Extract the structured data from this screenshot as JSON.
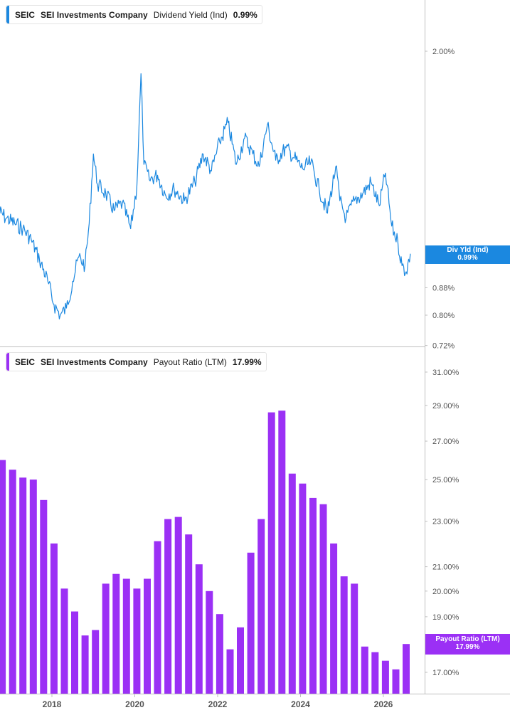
{
  "colors": {
    "dividend": "#1b88e0",
    "payout": "#9b30f5",
    "axis": "#bfbfbf",
    "tick_text": "#555555"
  },
  "top_legend": {
    "ticker": "SEIC",
    "company": "SEI Investments Company",
    "metric": "Dividend Yield (Ind)",
    "value": "0.99%"
  },
  "bottom_legend": {
    "ticker": "SEIC",
    "company": "SEI Investments Company",
    "metric": "Payout Ratio (LTM)",
    "value": "17.99%"
  },
  "top_tag": {
    "label": "Div Yld (Ind)",
    "value": "0.99%"
  },
  "bottom_tag": {
    "label": "Payout Ratio (LTM)",
    "value": "17.99%"
  },
  "chart_data": [
    {
      "type": "line",
      "series": [
        {
          "name": "Dividend Yield (Ind)",
          "unit": "%"
        }
      ],
      "y_scale": "log",
      "y_ticks": [
        "2.00%",
        "0.88%",
        "0.80%",
        "0.72%"
      ],
      "x": [
        2016.5,
        2016.7,
        2016.9,
        2017.1,
        2017.3,
        2017.5,
        2017.7,
        2017.9,
        2018.05,
        2018.2,
        2018.35,
        2018.5,
        2018.65,
        2018.8,
        2018.9,
        2019.0,
        2019.1,
        2019.3,
        2019.5,
        2019.7,
        2019.9,
        2020.05,
        2020.15,
        2020.22,
        2020.35,
        2020.55,
        2020.75,
        2020.95,
        2021.2,
        2021.45,
        2021.65,
        2021.85,
        2022.05,
        2022.25,
        2022.45,
        2022.65,
        2022.85,
        2023.0,
        2023.2,
        2023.4,
        2023.65,
        2023.85,
        2024.05,
        2024.25,
        2024.45,
        2024.65,
        2024.85,
        2024.95,
        2025.1,
        2025.3,
        2025.5,
        2025.7,
        2025.9,
        2026.05,
        2026.2,
        2026.35,
        2026.45,
        2026.55,
        2026.65
      ],
      "y": [
        1.16,
        1.15,
        1.12,
        1.1,
        1.08,
        1.04,
        0.97,
        0.9,
        0.83,
        0.8,
        0.82,
        0.9,
        0.98,
        0.95,
        1.1,
        1.4,
        1.26,
        1.22,
        1.15,
        1.18,
        1.08,
        1.25,
        1.85,
        1.35,
        1.28,
        1.3,
        1.21,
        1.24,
        1.19,
        1.27,
        1.4,
        1.32,
        1.46,
        1.56,
        1.35,
        1.48,
        1.4,
        1.34,
        1.55,
        1.37,
        1.43,
        1.38,
        1.33,
        1.36,
        1.24,
        1.14,
        1.34,
        1.19,
        1.12,
        1.19,
        1.22,
        1.27,
        1.17,
        1.31,
        1.09,
        1.03,
        0.95,
        0.93,
        0.99
      ],
      "x_ticks": [
        "2018",
        "2020",
        "2022",
        "2024",
        "2026"
      ]
    },
    {
      "type": "bar",
      "series": [
        {
          "name": "Payout Ratio (LTM)",
          "unit": "%"
        }
      ],
      "y_scale": "log",
      "y_ticks": [
        "31.00%",
        "29.00%",
        "27.00%",
        "25.00%",
        "23.00%",
        "21.00%",
        "20.00%",
        "19.00%",
        "17.00%"
      ],
      "x": [
        2016.8,
        2017.05,
        2017.3,
        2017.55,
        2017.8,
        2018.05,
        2018.3,
        2018.55,
        2018.8,
        2019.05,
        2019.3,
        2019.55,
        2019.8,
        2020.05,
        2020.3,
        2020.55,
        2020.8,
        2021.05,
        2021.3,
        2021.55,
        2021.8,
        2022.05,
        2022.3,
        2022.55,
        2022.8,
        2023.05,
        2023.3,
        2023.55,
        2023.8,
        2024.05,
        2024.3,
        2024.55,
        2024.8,
        2025.05,
        2025.3,
        2025.55,
        2025.8,
        2026.05,
        2026.3,
        2026.55
      ],
      "values": [
        26.0,
        25.5,
        25.1,
        25.0,
        24.0,
        22.0,
        20.1,
        19.2,
        18.3,
        18.5,
        20.3,
        20.7,
        20.5,
        20.1,
        20.5,
        22.1,
        23.1,
        23.2,
        22.4,
        21.1,
        20.0,
        19.1,
        17.8,
        18.6,
        21.6,
        23.1,
        28.6,
        28.7,
        25.3,
        24.8,
        24.1,
        23.8,
        22.0,
        20.6,
        20.3,
        17.9,
        17.7,
        17.4,
        17.1,
        17.99
      ],
      "x_ticks": [
        "2018",
        "2020",
        "2022",
        "2024",
        "2026"
      ]
    }
  ]
}
